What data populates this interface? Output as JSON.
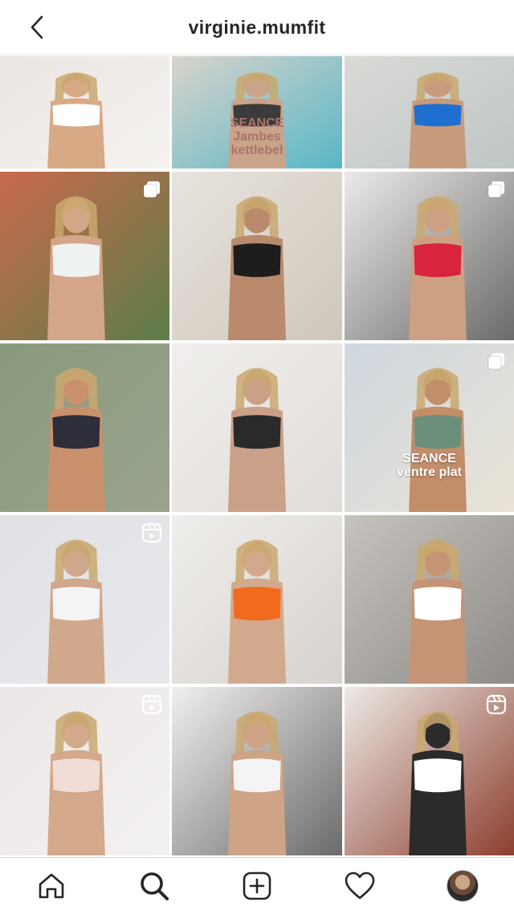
{
  "header": {
    "username": "virginie.mumfit",
    "back_icon": "chevron-left-icon"
  },
  "overlays": {
    "tile2": [
      "SEANCE",
      "Jambes",
      "kettlebel"
    ],
    "tile9": [
      "SEANCE",
      "ventre plat"
    ]
  },
  "tiles": [
    {
      "name": "post-pancakes-white-top",
      "badge": "none",
      "colors": [
        "#ece6e2",
        "#f4f2f0",
        "#d8a985",
        "#ffffff"
      ]
    },
    {
      "name": "post-pool-seance-jambes",
      "badge": "none",
      "colors": [
        "#d9d4cc",
        "#58b7c6",
        "#c9a38a",
        "#3b3b3b"
      ]
    },
    {
      "name": "post-blue-sports-set",
      "badge": "none",
      "colors": [
        "#d9dad6",
        "#bfc6c6",
        "#c79b7c",
        "#1f6fd1"
      ]
    },
    {
      "name": "post-mother-daughter",
      "badge": "carousel",
      "colors": [
        "#c96a4c",
        "#5c7d49",
        "#d4a688",
        "#eef2f0"
      ]
    },
    {
      "name": "post-black-bikini-mirror",
      "badge": "none",
      "colors": [
        "#e7e3dd",
        "#cfc7bb",
        "#b98a6c",
        "#1d1d1d"
      ]
    },
    {
      "name": "post-red-sports-bra",
      "badge": "carousel",
      "colors": [
        "#eceae8",
        "#6b6b6b",
        "#cda083",
        "#d8243c"
      ]
    },
    {
      "name": "post-floral-bikini",
      "badge": "none",
      "colors": [
        "#8a9a7c",
        "#9aa38d",
        "#c9906c",
        "#2e2d3a"
      ]
    },
    {
      "name": "post-chocolate-box",
      "badge": "none",
      "colors": [
        "#f1efed",
        "#e0dcd8",
        "#caa088",
        "#2a2a2a"
      ]
    },
    {
      "name": "post-seance-ventre-plat",
      "badge": "carousel",
      "colors": [
        "#cfd7df",
        "#e9e3d6",
        "#c28d69",
        "#6b8f7a"
      ]
    },
    {
      "name": "post-white-set-reel",
      "badge": "reel",
      "colors": [
        "#dfe1e5",
        "#e8e9ec",
        "#d0a88c",
        "#f4f4f4"
      ]
    },
    {
      "name": "post-orange-dress",
      "badge": "none",
      "colors": [
        "#f0eeec",
        "#d6d2cd",
        "#d3a98d",
        "#f06b1e"
      ]
    },
    {
      "name": "post-white-bikini-selfie",
      "badge": "none",
      "colors": [
        "#c6c3bf",
        "#8f8c88",
        "#c59474",
        "#ffffff"
      ]
    },
    {
      "name": "post-white-robe",
      "badge": "reel",
      "colors": [
        "#ebe7e6",
        "#f3f1f0",
        "#d3a88b",
        "#f1dcd6"
      ]
    },
    {
      "name": "post-balloon-gym",
      "badge": "none",
      "colors": [
        "#f1f0ee",
        "#6b6b6b",
        "#cfa386",
        "#f4f4f4"
      ]
    },
    {
      "name": "post-white-skirt-stairs",
      "badge": "reel",
      "colors": [
        "#eeeae6",
        "#8c3f2e",
        "#2b2b2b",
        "#ffffff"
      ]
    }
  ],
  "tabbar": [
    "home-icon",
    "search-icon",
    "new-post-icon",
    "activity-heart-icon",
    "profile-avatar"
  ]
}
